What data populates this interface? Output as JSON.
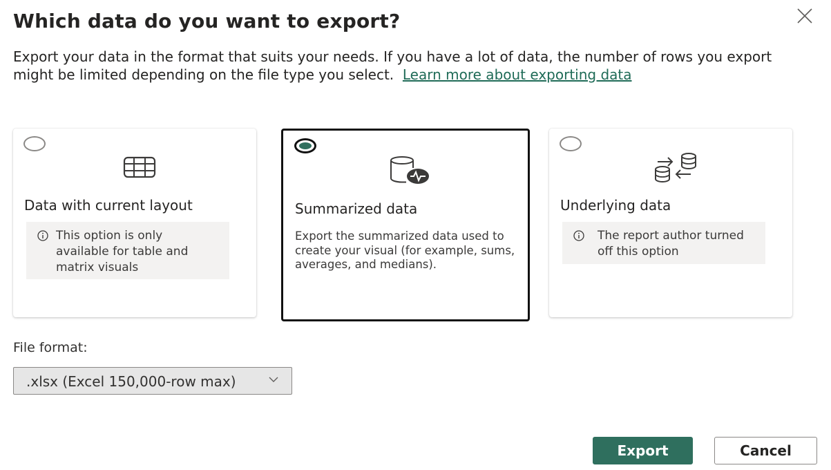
{
  "dialog": {
    "title": "Which data do you want to export?",
    "description": "Export your data in the format that suits your needs. If you have a lot of data, the number of rows you export might be limited depending on the file type you select.",
    "learn_more_link": "Learn more about exporting data",
    "accent_color": "#2f6f5e"
  },
  "options": [
    {
      "title": "Data with current layout",
      "icon": "table-grid-icon",
      "selected": false,
      "info": "This option is only available for table and matrix visuals"
    },
    {
      "title": "Summarized data",
      "icon": "database-pulse-icon",
      "selected": true,
      "description": "Export the summarized data used to create your visual (for example, sums, averages, and medians)."
    },
    {
      "title": "Underlying data",
      "icon": "data-transfer-icon",
      "selected": false,
      "info": "The report author turned off this option"
    }
  ],
  "file_format": {
    "label": "File format:",
    "selected": ".xlsx (Excel 150,000-row max)"
  },
  "buttons": {
    "export": "Export",
    "cancel": "Cancel"
  }
}
